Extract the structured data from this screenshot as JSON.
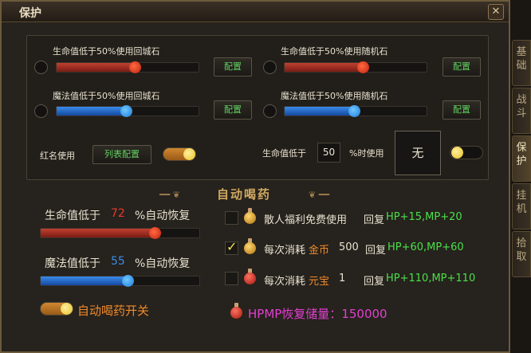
{
  "window": {
    "title": "保护",
    "close_glyph": "✕"
  },
  "top_section": {
    "rows": [
      {
        "label": "生命值低于50%使用回城石",
        "color": "red",
        "level": 0.55,
        "button": "配置"
      },
      {
        "label": "生命值低于50%使用随机石",
        "color": "red",
        "level": 0.55,
        "button": "配置"
      },
      {
        "label": "魔法值低于50%使用回城石",
        "color": "blue",
        "level": 0.55,
        "button": "配置"
      },
      {
        "label": "魔法值低于50%使用随机石",
        "color": "blue",
        "level": 0.55,
        "button": "配置"
      }
    ],
    "red_name": {
      "label": "红名使用",
      "button": "列表配置",
      "toggle_on": true
    },
    "hp_below": {
      "prefix": "生命值低于",
      "value": "50",
      "suffix": "%时使用",
      "item": "无",
      "toggle_on": false
    }
  },
  "auto_potion": {
    "title": "自动喝药",
    "hp": {
      "prefix": "生命值低于",
      "value": "72",
      "suffix": "%自动恢复",
      "level": 0.72
    },
    "mp": {
      "prefix": "魔法值低于",
      "value": "55",
      "suffix": "%自动恢复",
      "level": 0.55
    },
    "switch_label": "自动喝药开关",
    "switch_on": true,
    "options": [
      {
        "checked": false,
        "potion": "gold",
        "text": "散人福利免费使用",
        "currency": "",
        "cost": "",
        "restore_label": "回复",
        "restore": "HP+15,MP+20"
      },
      {
        "checked": true,
        "potion": "gold",
        "text": "每次消耗",
        "currency": "金币",
        "cost": "500",
        "restore_label": "回复",
        "restore": "HP+60,MP+60"
      },
      {
        "checked": false,
        "potion": "red",
        "text": "每次消耗",
        "currency": "元宝",
        "cost": "1",
        "restore_label": "回复",
        "restore": "HP+110,MP+110"
      }
    ],
    "reserve": "HPMP恢复储量：150000"
  },
  "side_tabs": [
    {
      "label": "基础",
      "active": false
    },
    {
      "label": "战斗",
      "active": false
    },
    {
      "label": "保护",
      "active": true
    },
    {
      "label": "挂机",
      "active": false
    },
    {
      "label": "拾取",
      "active": false
    }
  ]
}
